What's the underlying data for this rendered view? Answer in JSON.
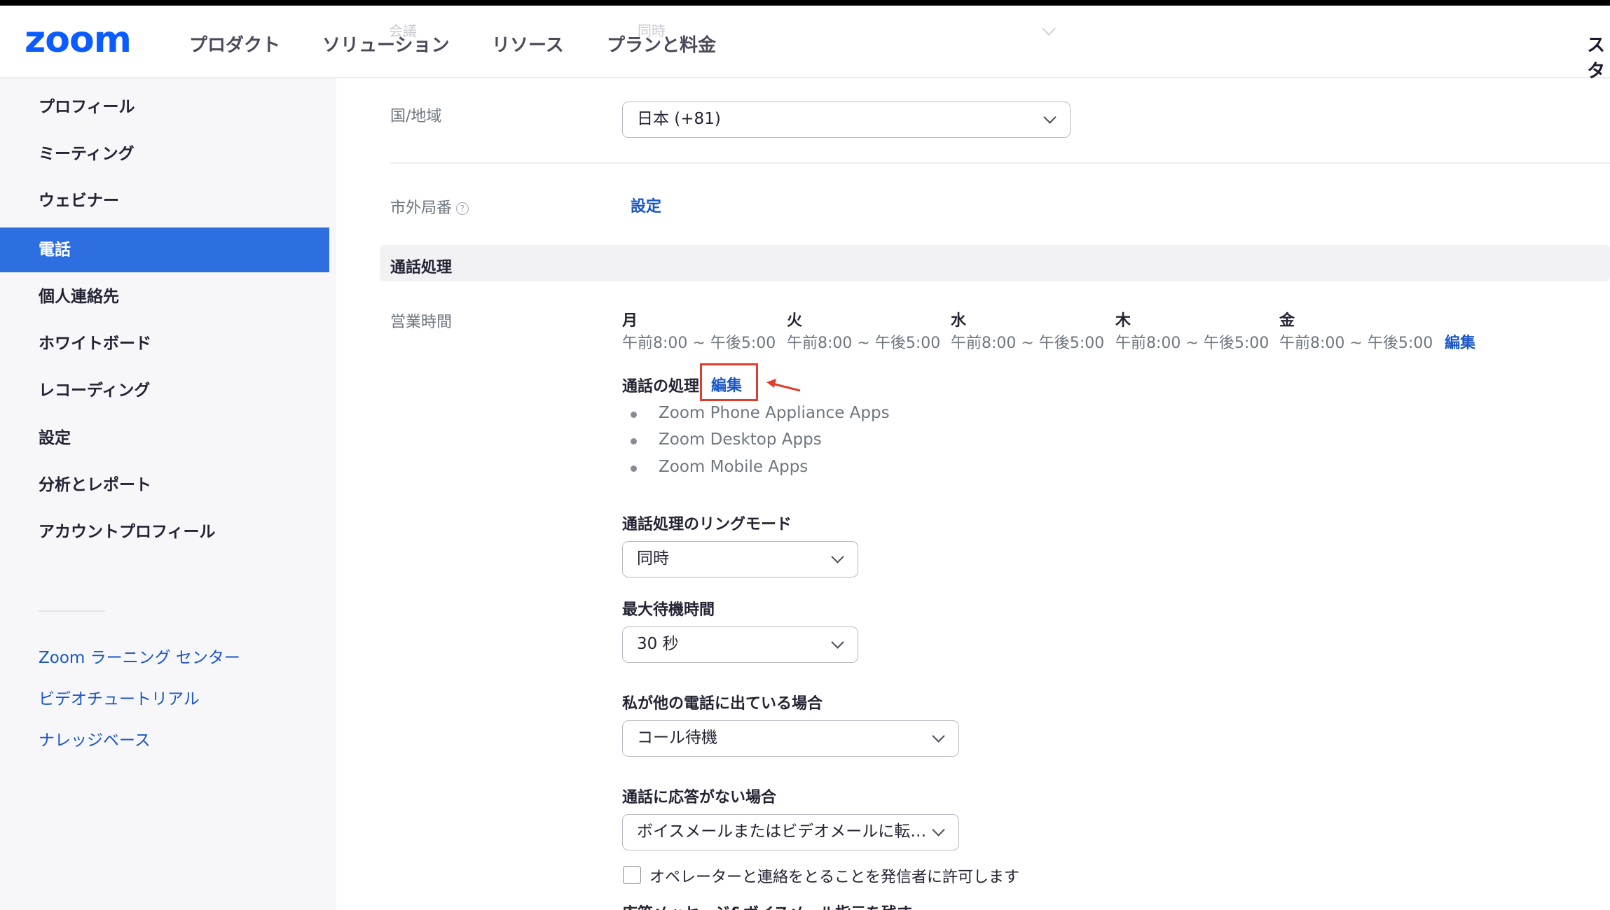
{
  "header": {
    "logo": "zoom",
    "nav": [
      "プロダクト",
      "ソリューション",
      "リソース",
      "プランと料金"
    ],
    "nav_cut": "スタ",
    "ghost_label": "会議",
    "ghost_value": "同時"
  },
  "sidebar": {
    "items": [
      "プロフィール",
      "ミーティング",
      "ウェビナー",
      "電話",
      "個人連絡先",
      "ホワイトボード",
      "レコーディング",
      "設定",
      "分析とレポート",
      "アカウントプロフィール"
    ],
    "active_index": 3,
    "links": [
      "Zoom ラーニング センター",
      "ビデオチュートリアル",
      "ナレッジベース"
    ]
  },
  "main": {
    "country_label": "国/地域",
    "country_value": "日本 (+81)",
    "outside_label": "市外局番",
    "help_glyph": "?",
    "outside_link": "設定",
    "section_title": "通話処理",
    "hours_label": "営業時間",
    "days": [
      {
        "day": "月",
        "hours": "午前8:00 ~ 午後5:00"
      },
      {
        "day": "火",
        "hours": "午前8:00 ~ 午後5:00"
      },
      {
        "day": "水",
        "hours": "午前8:00 ~ 午後5:00"
      },
      {
        "day": "木",
        "hours": "午前8:00 ~ 午後5:00"
      },
      {
        "day": "金",
        "hours": "午前8:00 ~ 午後5:00"
      }
    ],
    "hours_edit": "編集",
    "handling_title": "通話の処理",
    "handling_edit": "編集",
    "apps": [
      "Zoom Phone Appliance Apps",
      "Zoom Desktop Apps",
      "Zoom Mobile Apps"
    ],
    "ring_mode_title": "通話処理のリングモード",
    "ring_mode_value": "同時",
    "max_wait_title": "最大待機時間",
    "max_wait_value": "30 秒",
    "busy_title": "私が他の電話に出ている場合",
    "busy_value": "コール待機",
    "no_answer_title": "通話に応答がない場合",
    "no_answer_value": "ボイスメールまたはビデオメールに転…",
    "operator_checkbox_label": "オペレーターと連絡をとることを発信者に許可します",
    "operator_checked": false,
    "cut_text": "応答メッセージ&ボイスメール指示を残す"
  },
  "colors": {
    "accent": "#2d6fe0",
    "link": "#1a56c5",
    "highlight": "#e23c2c",
    "logo": "#0b5cff"
  }
}
